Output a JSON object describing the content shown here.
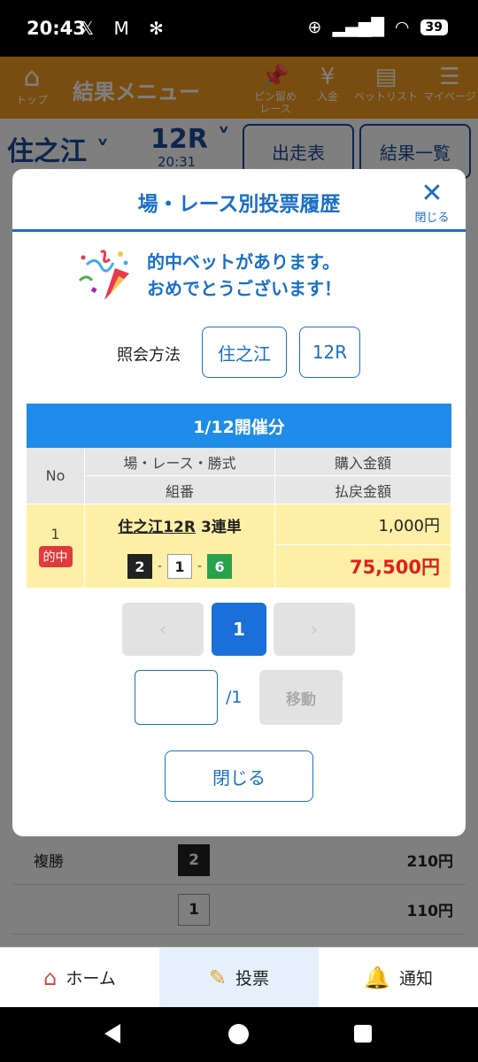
{
  "status": {
    "time": "20:43",
    "notif_icons": "𝕏 M ✻",
    "battery": "39"
  },
  "header": {
    "home_label": "トップ",
    "title": "結果メニュー",
    "pinned_label": "ピン留め\nレース",
    "deposit_label": "入金",
    "betlist_label": "ベットリスト",
    "mypage_label": "マイページ"
  },
  "subbar": {
    "venue": "住之江",
    "race": "12R",
    "race_time": "20:31",
    "entries_button": "出走表",
    "results_button": "結果一覧"
  },
  "background_rows": [
    {
      "type": "複勝",
      "num": "2",
      "color": "black",
      "pay": "210円"
    },
    {
      "type": "",
      "num": "1",
      "color": "white",
      "pay": "110円"
    }
  ],
  "modal": {
    "title": "場・レース別投票履歴",
    "close_label": "閉じる",
    "congrats_line1": "的中ベットがあります。",
    "congrats_line2": "おめでとうございます！",
    "query_label": "照会方法",
    "query_venue": "住之江",
    "query_race": "12R",
    "table_title": "1/12開催分",
    "headers": {
      "no": "No",
      "race_type": "場・レース・勝式",
      "purchase": "購入金額",
      "combination": "組番",
      "payout": "払戻金額"
    },
    "row": {
      "no": "1",
      "hit_badge": "的中",
      "race_link": "住之江12R",
      "bet_type": "3連単",
      "purchase": "1,000円",
      "combo": [
        "2",
        "1",
        "6"
      ],
      "separator": "-",
      "payout": "75,500円"
    },
    "pagination": {
      "prev": "‹",
      "current": "1",
      "next": "›"
    },
    "page_input_value": "",
    "page_total": "/1",
    "move_button": "移動",
    "close_button": "閉じる"
  },
  "tabs": [
    {
      "label": "ホーム",
      "icon": "house-icon"
    },
    {
      "label": "投票",
      "icon": "ticket-icon"
    },
    {
      "label": "通知",
      "icon": "bell-icon"
    }
  ],
  "colors": {
    "accent_blue": "#1a6fc6",
    "header_orange": "#f39a1e",
    "payout_red": "#e01e1e",
    "hit_row": "#fdf0a6"
  }
}
